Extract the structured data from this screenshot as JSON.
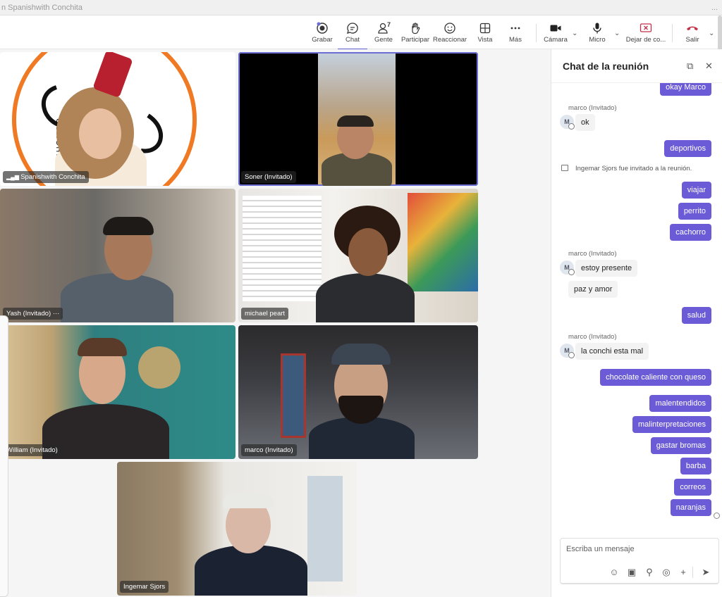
{
  "window": {
    "title": "n Spanishwith Conchita",
    "menu": "..."
  },
  "toolbar": {
    "record": "Grabar",
    "chat": "Chat",
    "people": "Gente",
    "people_count": "7",
    "raise": "Participar",
    "react": "Reaccionar",
    "view": "Vista",
    "more": "Más",
    "camera": "Cámara",
    "mic": "Micro",
    "share": "Dejar de co...",
    "leave": "Salir",
    "leave_color": "#c4314b"
  },
  "tiles": [
    {
      "name": "Spanishwith Conchita",
      "logo_text": "CONCHITA"
    },
    {
      "name": "Soner (Invitado)"
    },
    {
      "name": "Yash (Invitado)",
      "more": "···"
    },
    {
      "name": "michael peart"
    },
    {
      "name": "William (Invitado)"
    },
    {
      "name": "marco (Invitado)"
    },
    {
      "name": "Ingemar Sjors"
    }
  ],
  "chat": {
    "title": "Chat de la reunión",
    "accent": "#6b5bd6",
    "placeholder": "Escriba un mensaje",
    "messages": {
      "m1": "okay Marco",
      "s1": "marco (Invitado)",
      "a1": "M",
      "t1": "ok",
      "m2": "deportivos",
      "sys": "Ingemar Sjors fue invitado a la reunión.",
      "m3": "viajar",
      "m4": "perrito",
      "m5": "cachorro",
      "s2": "marco (Invitado)",
      "a2": "M",
      "t2": "estoy presente",
      "t3": "paz y amor",
      "m6": "salud",
      "s3": "marco (Invitado)",
      "a3": "M",
      "t4": "la conchi esta mal",
      "m7": "chocolate caliente con queso",
      "m8": "malentendidos",
      "m9": "malinterpretaciones",
      "m10": "gastar bromas",
      "m11": "barba",
      "m12": "correos",
      "m13": "naranjas"
    }
  }
}
